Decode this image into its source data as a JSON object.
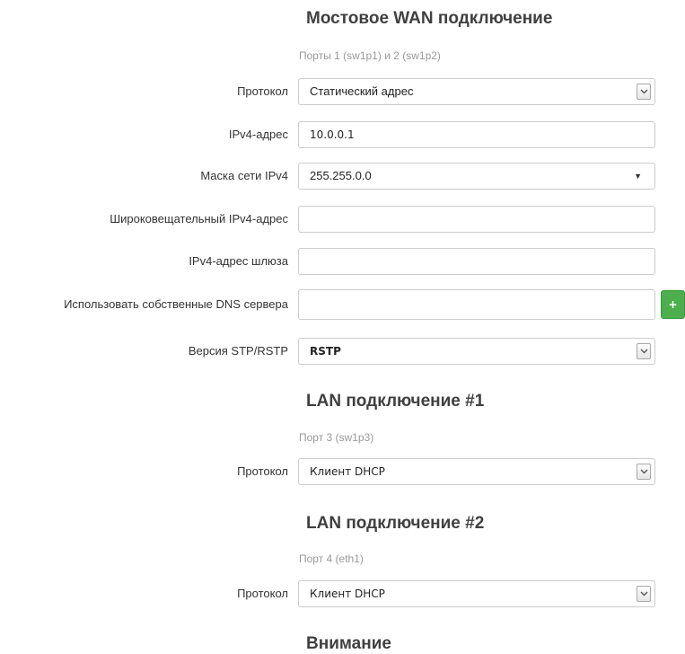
{
  "wan": {
    "title": "Мостовое WAN подключение",
    "description": "Порты 1 (sw1p1) и 2 (sw1p2)",
    "protocol": {
      "label": "Протокол",
      "value": "Статический адрес"
    },
    "ipv4_address": {
      "label": "IPv4-адрес",
      "value": "10.0.0.1"
    },
    "netmask": {
      "label": "Маска сети IPv4",
      "value": "255.255.0.0"
    },
    "broadcast": {
      "label": "Широковещательный IPv4-адрес",
      "value": ""
    },
    "gateway": {
      "label": "IPv4-адрес шлюза",
      "value": ""
    },
    "custom_dns": {
      "label": "Использовать собственные DNS сервера",
      "value": "",
      "add_label": "+"
    },
    "stp": {
      "label": "Версия STP/RSTP",
      "value": "RSTP"
    }
  },
  "lan1": {
    "title": "LAN подключение #1",
    "description": "Порт 3 (sw1p3)",
    "protocol": {
      "label": "Протокол",
      "value": "Клиент DHCP"
    }
  },
  "lan2": {
    "title": "LAN подключение #2",
    "description": "Порт 4 (eth1)",
    "protocol": {
      "label": "Протокол",
      "value": "Клиент DHCP"
    }
  },
  "notice": {
    "title": "Внимание"
  },
  "colors": {
    "accent_button": "#4cae4c",
    "heading": "#404040",
    "muted": "#999999"
  }
}
